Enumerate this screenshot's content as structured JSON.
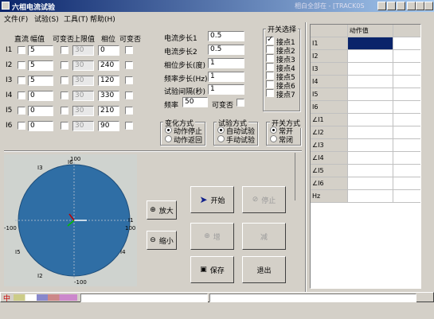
{
  "title": "六相电流试验",
  "title_right": "相白全部在 - [TRACK0S",
  "menu": [
    "文件(F)",
    "试验(S)",
    "工具(T)",
    "帮助(H)"
  ],
  "headers": {
    "dc": "直流",
    "amp": "幅值",
    "var": "可变否",
    "upper": "上限值",
    "phase": "相位",
    "phase_var": "可变否"
  },
  "rows": [
    {
      "label": "I1",
      "amp": "5",
      "upper": "30",
      "phase": "0"
    },
    {
      "label": "I2",
      "amp": "5",
      "upper": "30",
      "phase": "240"
    },
    {
      "label": "I3",
      "amp": "5",
      "upper": "30",
      "phase": "120"
    },
    {
      "label": "I4",
      "amp": "0",
      "upper": "30",
      "phase": "330"
    },
    {
      "label": "I5",
      "amp": "0",
      "upper": "30",
      "phase": "210"
    },
    {
      "label": "I6",
      "amp": "0",
      "upper": "30",
      "phase": "90"
    }
  ],
  "params": [
    {
      "label": "电流步长1",
      "value": "0.5"
    },
    {
      "label": "电流步长2",
      "value": "0.5"
    },
    {
      "label": "相位步长(度)",
      "value": "1"
    },
    {
      "label": "频率步长(Hz)",
      "value": "1"
    },
    {
      "label": "试验间隔(秒)",
      "value": "1"
    }
  ],
  "freq": {
    "label": "频率",
    "value": "50",
    "var_label": "可变否"
  },
  "switch_select": {
    "title": "开关选择",
    "items": [
      "接点1",
      "接点2",
      "接点3",
      "接点4",
      "接点5",
      "接点6",
      "接点7"
    ],
    "checked": [
      true,
      false,
      false,
      false,
      false,
      false,
      false
    ]
  },
  "change_mode": {
    "title": "变化方式",
    "options": [
      "动作停止",
      "动作返回"
    ],
    "selected": 0
  },
  "test_mode": {
    "title": "试验方式",
    "options": [
      "自动试验",
      "手动试验"
    ],
    "selected": 0
  },
  "switch_mode": {
    "title": "开关方式",
    "options": [
      "常开",
      "常闭"
    ],
    "selected": 0
  },
  "phasor": {
    "labels": {
      "top": "100",
      "bottom": "-100",
      "left": "-100",
      "right": "100",
      "i1": "I1",
      "i2": "I2",
      "i3": "I3",
      "i4": "I4",
      "i5": "I5",
      "i6": "I6"
    },
    "color": "#2f6ea5"
  },
  "buttons": {
    "zoom_in": "放大",
    "zoom_out": "缩小",
    "start": "开始",
    "stop": "停止",
    "add": "增",
    "reduce": "减",
    "save": "保存",
    "exit": "退出"
  },
  "table": {
    "header": "动作值",
    "rows": [
      "I1",
      "I2",
      "I3",
      "I4",
      "I5",
      "I6",
      "∠I1",
      "∠I2",
      "∠I3",
      "∠I4",
      "∠I5",
      "∠I6",
      "Hz"
    ]
  },
  "taskbar": {
    "ime": "中"
  }
}
